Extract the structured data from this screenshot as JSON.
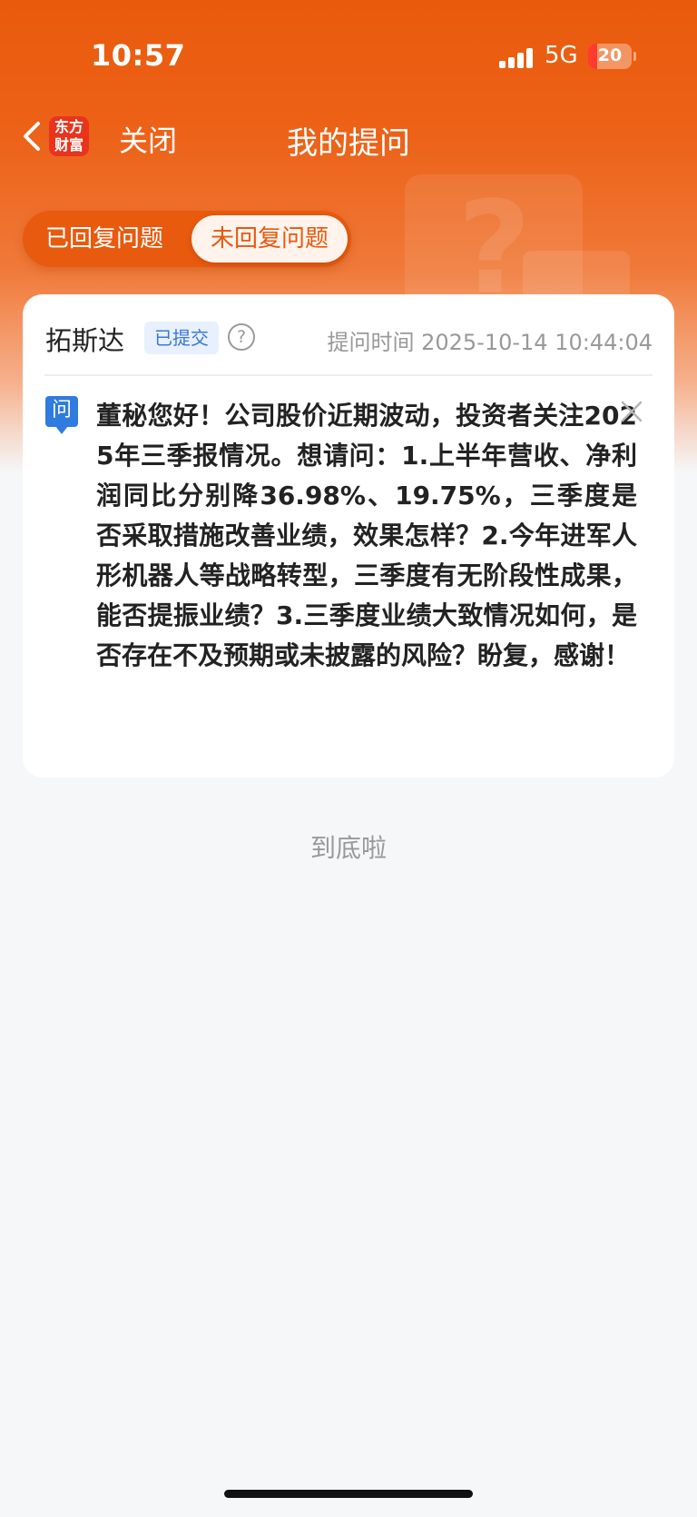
{
  "status_bar": {
    "time": "10:57",
    "network": "5G",
    "battery": "20",
    "battery_level": 0.2
  },
  "navbar": {
    "back_icon": "chevron-left-icon",
    "logo_text": [
      "东方",
      "财富"
    ],
    "close_label": "关闭",
    "title": "我的提问"
  },
  "tabs": [
    {
      "label": "已回复问题",
      "active": false
    },
    {
      "label": "未回复问题",
      "active": true
    }
  ],
  "question": {
    "author": "拓斯达",
    "status_badge": "已提交",
    "help_icon": "question-circle-icon",
    "time_label": "提问时间 2025-10-14 10:44:04",
    "q_icon_text": "问",
    "text": "董秘您好！公司股价近期波动，投资者关注2025年三季报情况。想请问：1.上半年营收、净利润同比分别降36.98%、19.75%，三季度是否采取措施改善业绩，效果怎样？2.今年进军人形机器人等战略转型，三季度有无阶段性成果，能否提振业绩？3.三季度业绩大致情况如何，是否存在不及预期或未披露的风险？盼复，感谢！",
    "close_icon": "close-icon"
  },
  "footer": {
    "end_text": "到底啦"
  },
  "colors": {
    "brand_orange": "#ea5a0c",
    "badge_blue": "#3a78d6",
    "q_icon_blue": "#2f7be0",
    "logo_red": "#e8341c"
  }
}
